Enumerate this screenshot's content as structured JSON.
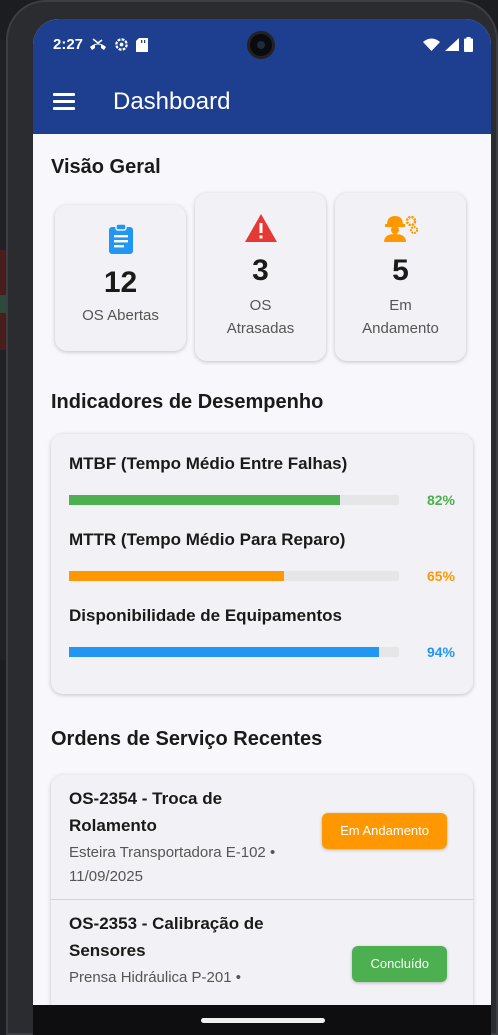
{
  "status": {
    "time": "2:27"
  },
  "appbar": {
    "title": "Dashboard"
  },
  "overview": {
    "title": "Visão Geral",
    "cards": [
      {
        "icon": "clipboard-icon",
        "value": "12",
        "label": "OS Abertas",
        "icon_color": "#2196f3"
      },
      {
        "icon": "warning-icon",
        "value": "3",
        "label_line1": "OS",
        "label_line2": "Atrasadas",
        "icon_color": "#e53935"
      },
      {
        "icon": "engineer-icon",
        "value": "5",
        "label_line1": "Em",
        "label_line2": "Andamento",
        "icon_color": "#ff9800"
      }
    ]
  },
  "kpi": {
    "title": "Indicadores de Desempenho",
    "items": [
      {
        "label": "MTBF (Tempo Médio Entre Falhas)",
        "percent": 82,
        "percent_label": "82%",
        "color": "#4caf50"
      },
      {
        "label": "MTTR (Tempo Médio Para Reparo)",
        "percent": 65,
        "percent_label": "65%",
        "color": "#ff9800"
      },
      {
        "label": "Disponibilidade de Equipamentos",
        "percent": 94,
        "percent_label": "94%",
        "color": "#2196f3"
      }
    ]
  },
  "recent": {
    "title": "Ordens de Serviço Recentes",
    "orders": [
      {
        "title_line1": "OS-2354 - Troca de",
        "title_line2": "Rolamento",
        "meta_line1": "Esteira Transportadora E-102 •",
        "meta_line2": "11/09/2025",
        "status": "Em Andamento",
        "status_color": "#ff9800"
      },
      {
        "title_line1": "OS-2353 - Calibração de",
        "title_line2": "Sensores",
        "meta_line1": "Prensa Hidráulica P-201 •",
        "meta_line2": "",
        "status": "Concluído",
        "status_color": "#4caf50"
      }
    ]
  },
  "colors": {
    "primary": "#1e3f8f",
    "background": "#f8f8fc"
  }
}
